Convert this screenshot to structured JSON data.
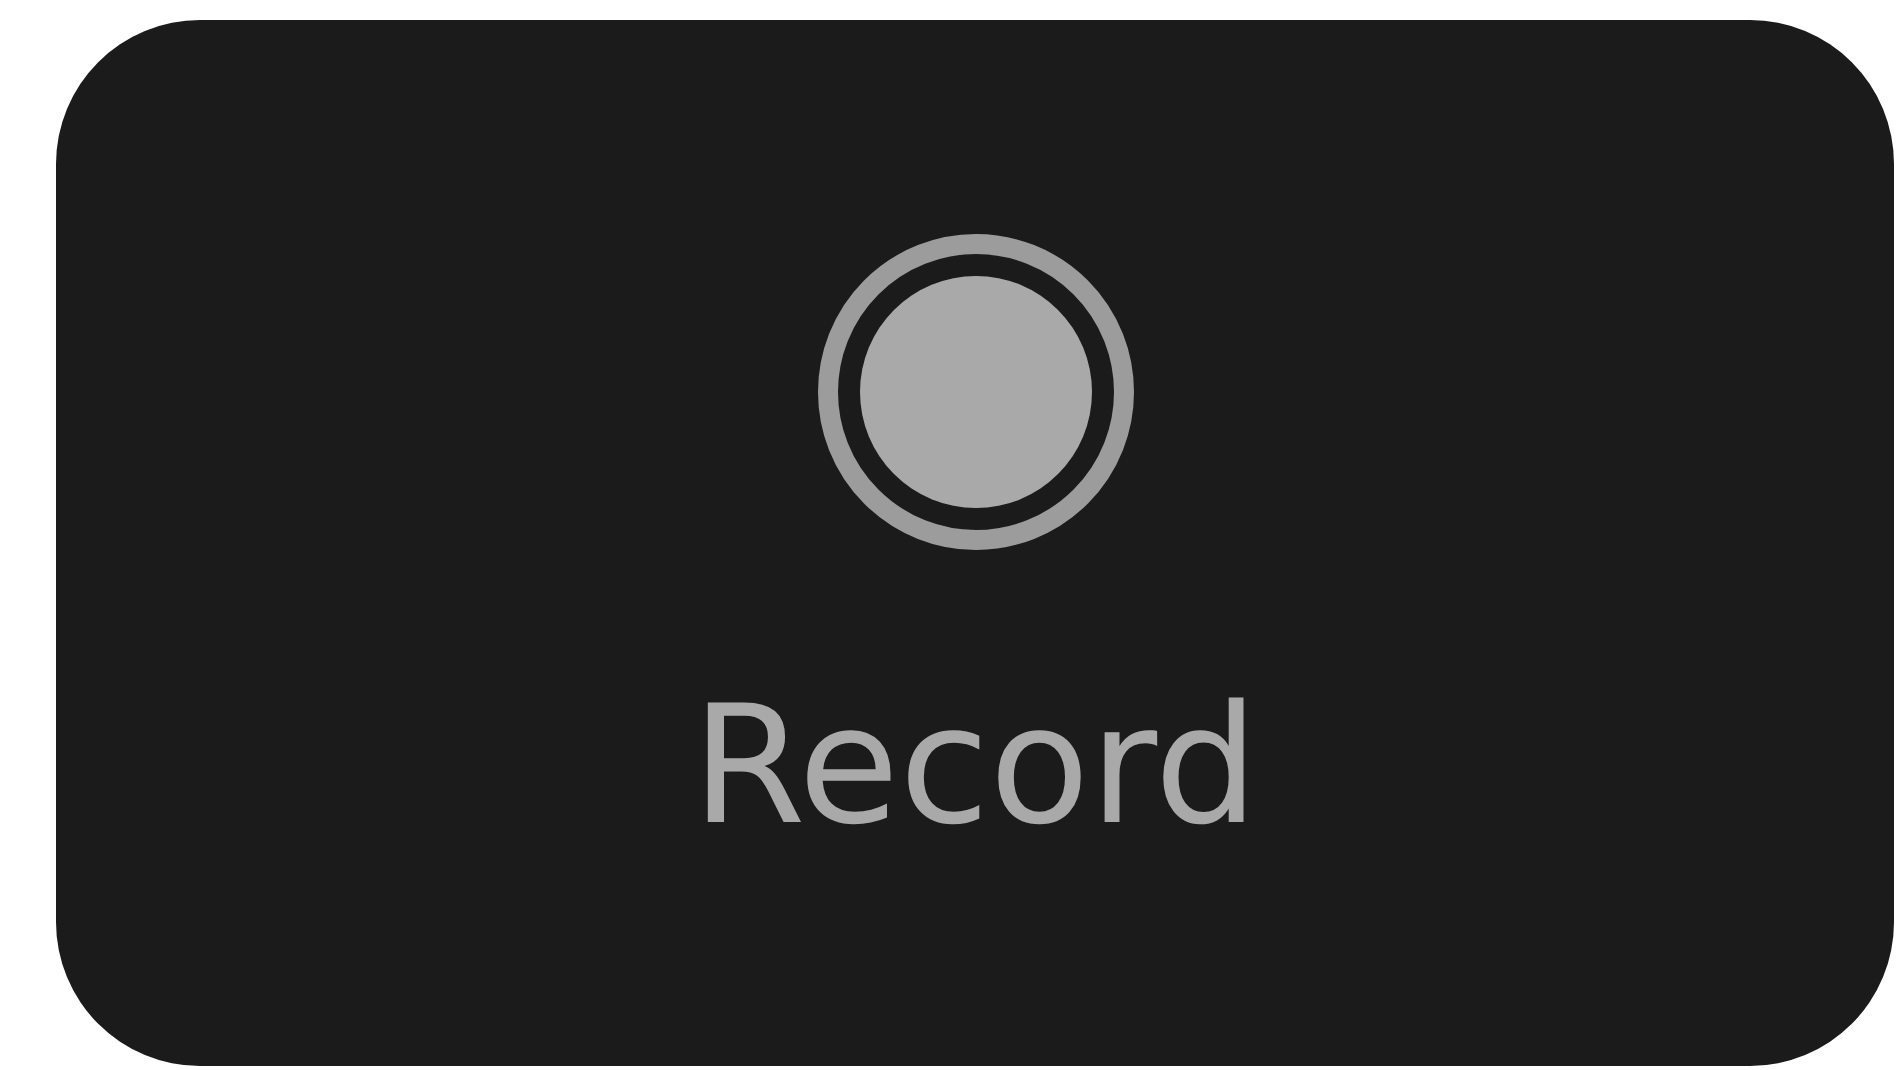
{
  "button": {
    "label": "Record"
  }
}
